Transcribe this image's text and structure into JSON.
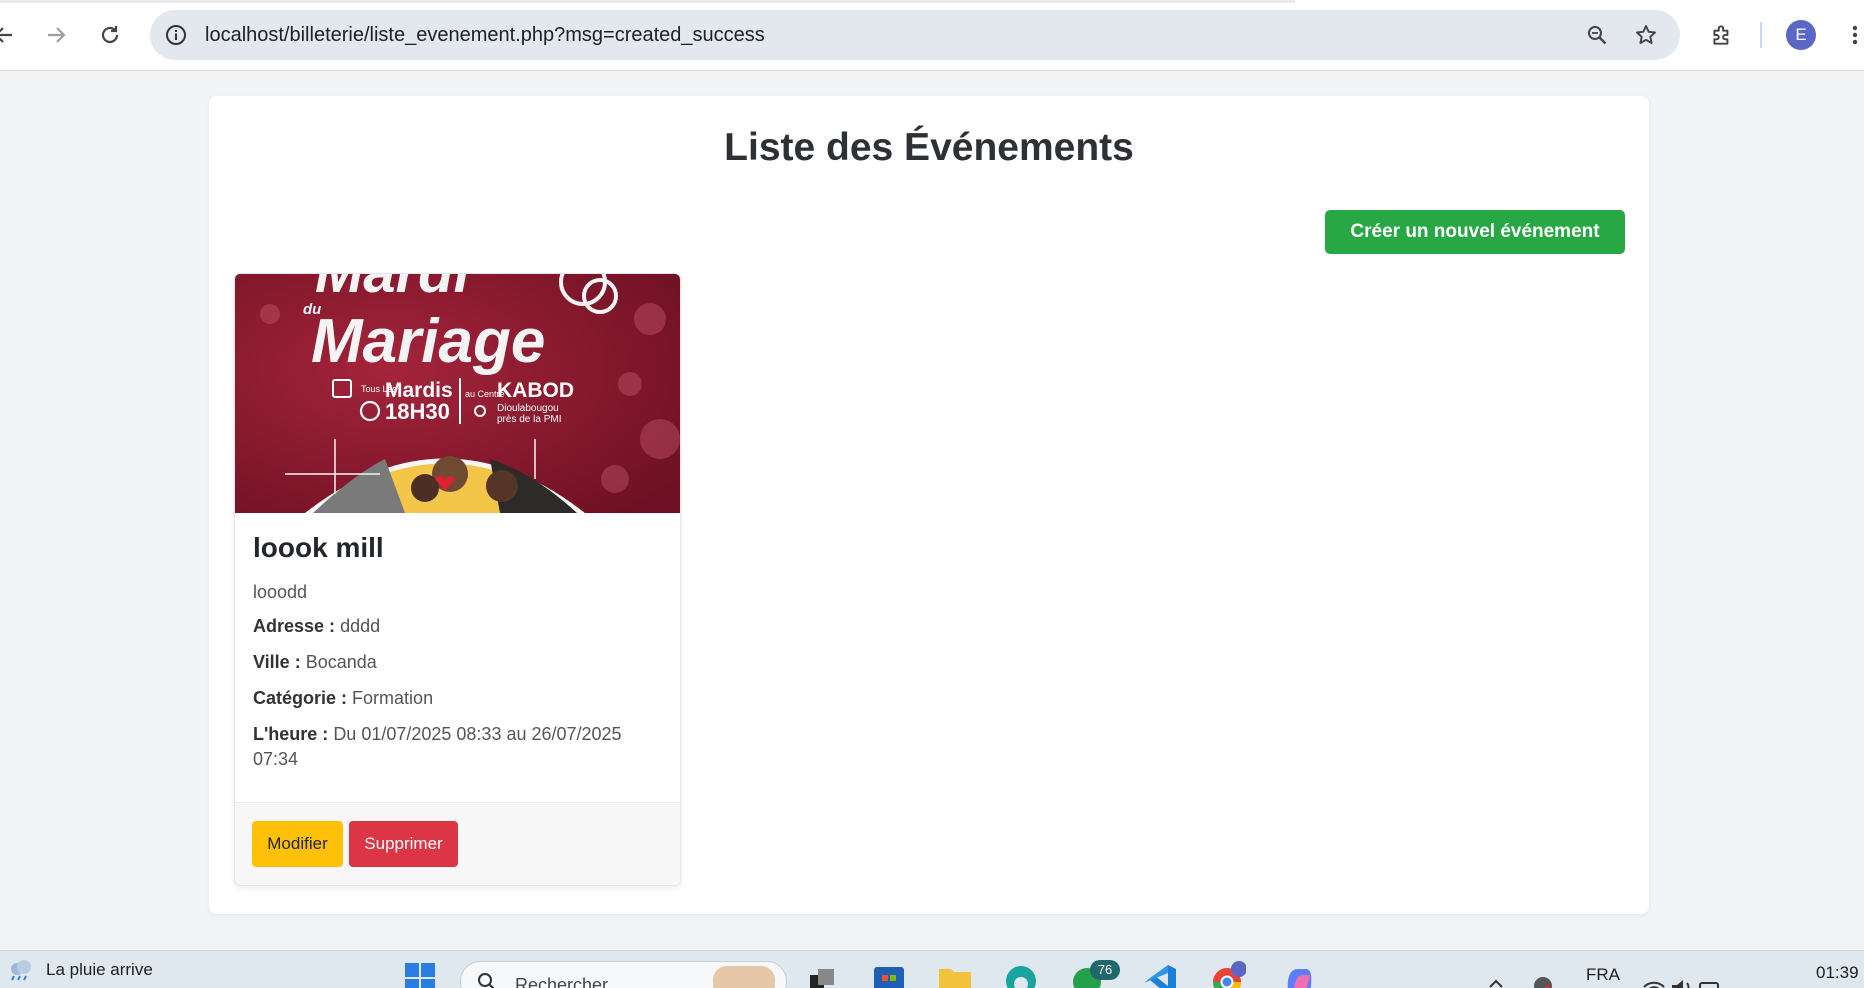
{
  "browser": {
    "url": "localhost/billeterie/liste_evenement.php?msg=created_success",
    "profile_initial": "E"
  },
  "page": {
    "title": "Liste des Événements",
    "create_button": "Créer un nouvel événement"
  },
  "event": {
    "title": "loook mill",
    "description": "looodd",
    "address_label": "Adresse :",
    "address": "dddd",
    "city_label": "Ville :",
    "city": "Bocanda",
    "category_label": "Catégorie :",
    "category": "Formation",
    "time_label": "L'heure :",
    "time": "Du 01/07/2025 08:33 au 26/07/2025 07:34",
    "edit_button": "Modifier",
    "delete_button": "Supprimer",
    "poster": {
      "title_top": "Mardi",
      "title_small": "du",
      "title_main": "Mariage",
      "days_small": "Tous Les",
      "days": "Mardis",
      "time": "18H30",
      "venue_small": "au Centre",
      "venue": "KABOD",
      "location_line1": "Dioulabougou",
      "location_line2": "près de la PMI"
    }
  },
  "taskbar": {
    "weather": "La pluie arrive",
    "search_placeholder": "Rechercher",
    "whatsapp_badge": "76",
    "language": "FRA",
    "clock": "01:39"
  }
}
